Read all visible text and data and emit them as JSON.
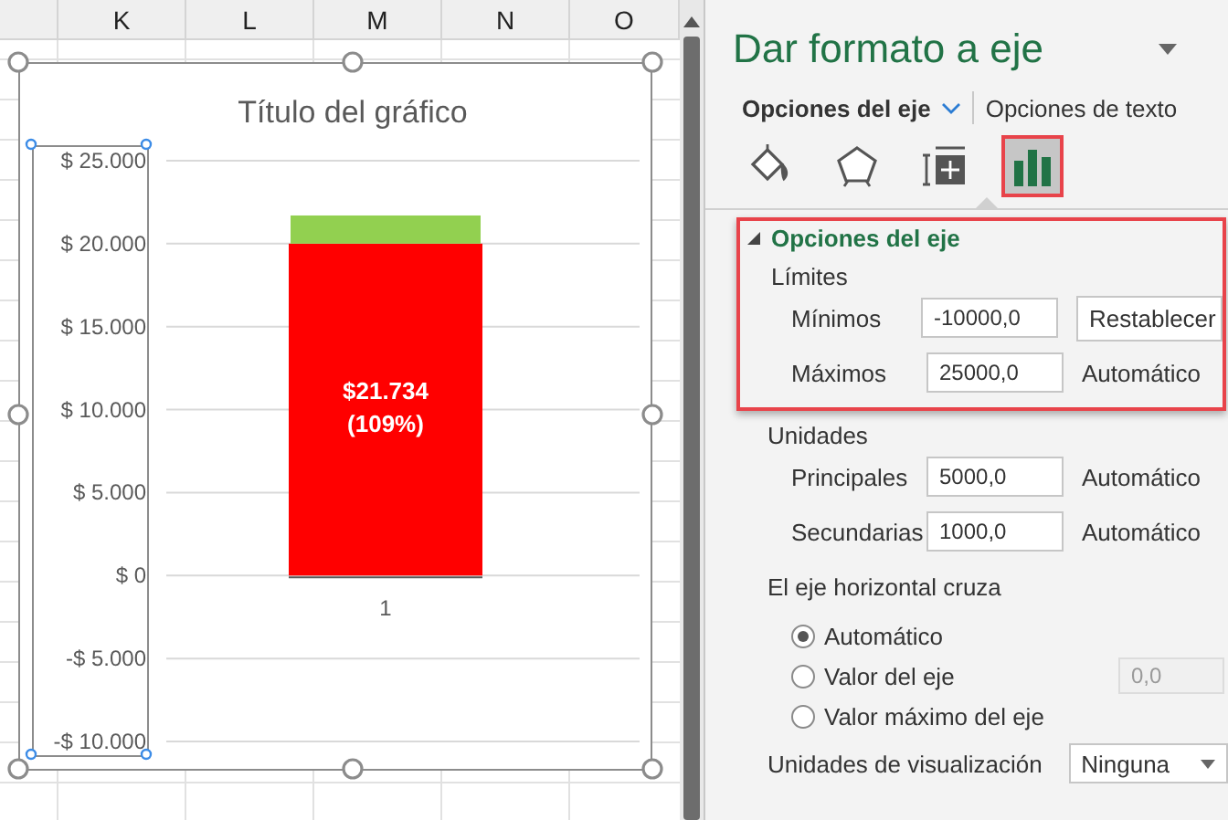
{
  "sheet": {
    "columns": [
      "K",
      "L",
      "M",
      "N",
      "O"
    ]
  },
  "chart": {
    "title": "Título del gráfico",
    "chart_data": {
      "type": "bar",
      "stacked": true,
      "categories": [
        "1"
      ],
      "series": [
        {
          "color": "#ff0000",
          "values": [
            20000
          ]
        },
        {
          "color": "#92d050",
          "values": [
            1700
          ]
        }
      ],
      "grid": true,
      "ylim": [
        -10000,
        25000
      ],
      "yticks": [
        {
          "value": 25000,
          "label": "$ 25.000"
        },
        {
          "value": 20000,
          "label": "$ 20.000"
        },
        {
          "value": 15000,
          "label": "$ 15.000"
        },
        {
          "value": 10000,
          "label": "$ 10.000"
        },
        {
          "value": 5000,
          "label": "$ 5.000"
        },
        {
          "value": 0,
          "label": "$ 0"
        },
        {
          "value": -5000,
          "label": "-$ 5.000"
        },
        {
          "value": -10000,
          "label": "-$ 10.000"
        }
      ],
      "annotations": [
        {
          "text": "$21.734"
        },
        {
          "text": "(109%)"
        }
      ]
    }
  },
  "panel": {
    "title": "Dar formato a eje",
    "tabs": [
      {
        "label": "Opciones del eje",
        "selected": true
      },
      {
        "label": "Opciones de texto",
        "selected": false
      }
    ],
    "icon_tabs": [
      {
        "kind": "fill",
        "selected": false
      },
      {
        "kind": "shape",
        "selected": false
      },
      {
        "kind": "size",
        "selected": false
      },
      {
        "kind": "chart",
        "selected": true
      }
    ],
    "section": {
      "title": "Opciones del eje",
      "expanded": true,
      "highlighted": true,
      "limits": {
        "title": "Límites",
        "rows": [
          {
            "label": "Mínimos",
            "value": "-10000,0",
            "action": {
              "kind": "button",
              "label": "Restablecer"
            }
          },
          {
            "label": "Máximos",
            "value": "25000,0",
            "action": {
              "kind": "text",
              "label": "Automático"
            }
          }
        ]
      },
      "units": {
        "title": "Unidades",
        "rows": [
          {
            "label": "Principales",
            "value": "5000,0",
            "action": {
              "kind": "text",
              "label": "Automático"
            }
          },
          {
            "label": "Secundarias",
            "value": "1000,0",
            "action": {
              "kind": "text",
              "label": "Automático"
            }
          }
        ]
      },
      "crosses": {
        "title": "El eje horizontal cruza",
        "options": [
          {
            "label": "Automático",
            "selected": true
          },
          {
            "label": "Valor del eje",
            "selected": false,
            "value": "0,0",
            "disabled": true
          },
          {
            "label": "Valor máximo del eje",
            "selected": false
          }
        ]
      },
      "display_units": {
        "label": "Unidades de visualización",
        "value": "Ninguna"
      }
    }
  }
}
